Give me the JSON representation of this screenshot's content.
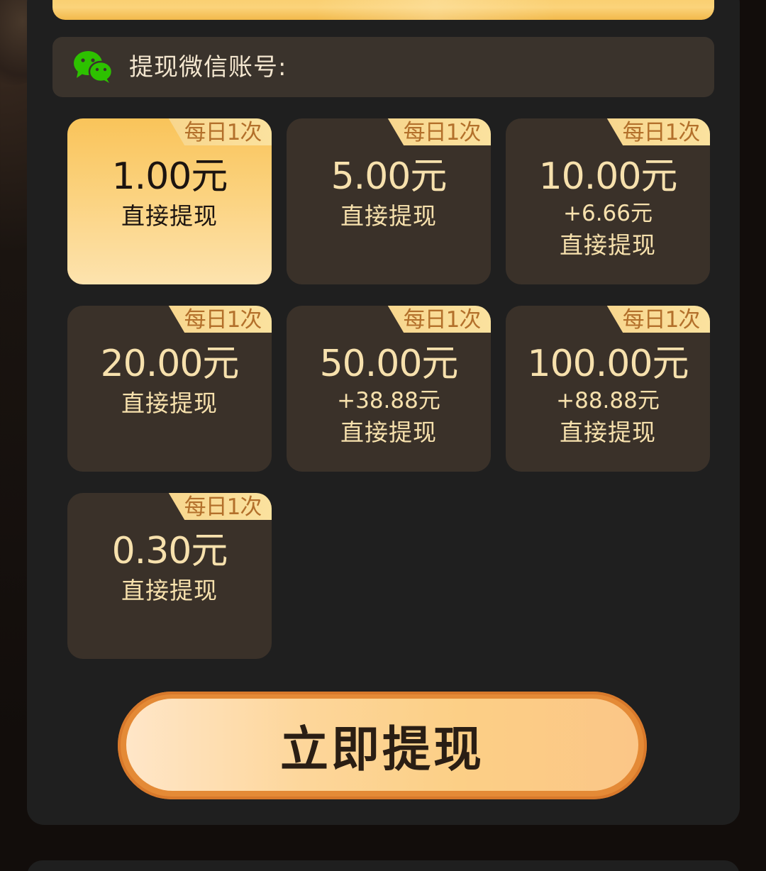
{
  "account": {
    "label": "提现微信账号:"
  },
  "options": [
    {
      "amount": "1.00元",
      "bonus": "",
      "sub": "直接提现",
      "tag": "每日1次",
      "selected": true
    },
    {
      "amount": "5.00元",
      "bonus": "",
      "sub": "直接提现",
      "tag": "每日1次",
      "selected": false
    },
    {
      "amount": "10.00元",
      "bonus": "+6.66元",
      "sub": "直接提现",
      "tag": "每日1次",
      "selected": false
    },
    {
      "amount": "20.00元",
      "bonus": "",
      "sub": "直接提现",
      "tag": "每日1次",
      "selected": false
    },
    {
      "amount": "50.00元",
      "bonus": "+38.88元",
      "sub": "直接提现",
      "tag": "每日1次",
      "selected": false
    },
    {
      "amount": "100.00元",
      "bonus": "+88.88元",
      "sub": "直接提现",
      "tag": "每日1次",
      "selected": false
    },
    {
      "amount": "0.30元",
      "bonus": "",
      "sub": "直接提现",
      "tag": "每日1次",
      "selected": false
    }
  ],
  "button": {
    "label": "立即提现"
  },
  "colors": {
    "accent": "#f9c45a",
    "card_bg": "#3a3129",
    "text_gold": "#f7e1ad",
    "wechat_green": "#2dc100"
  },
  "icons": {
    "account": "wechat-icon"
  }
}
